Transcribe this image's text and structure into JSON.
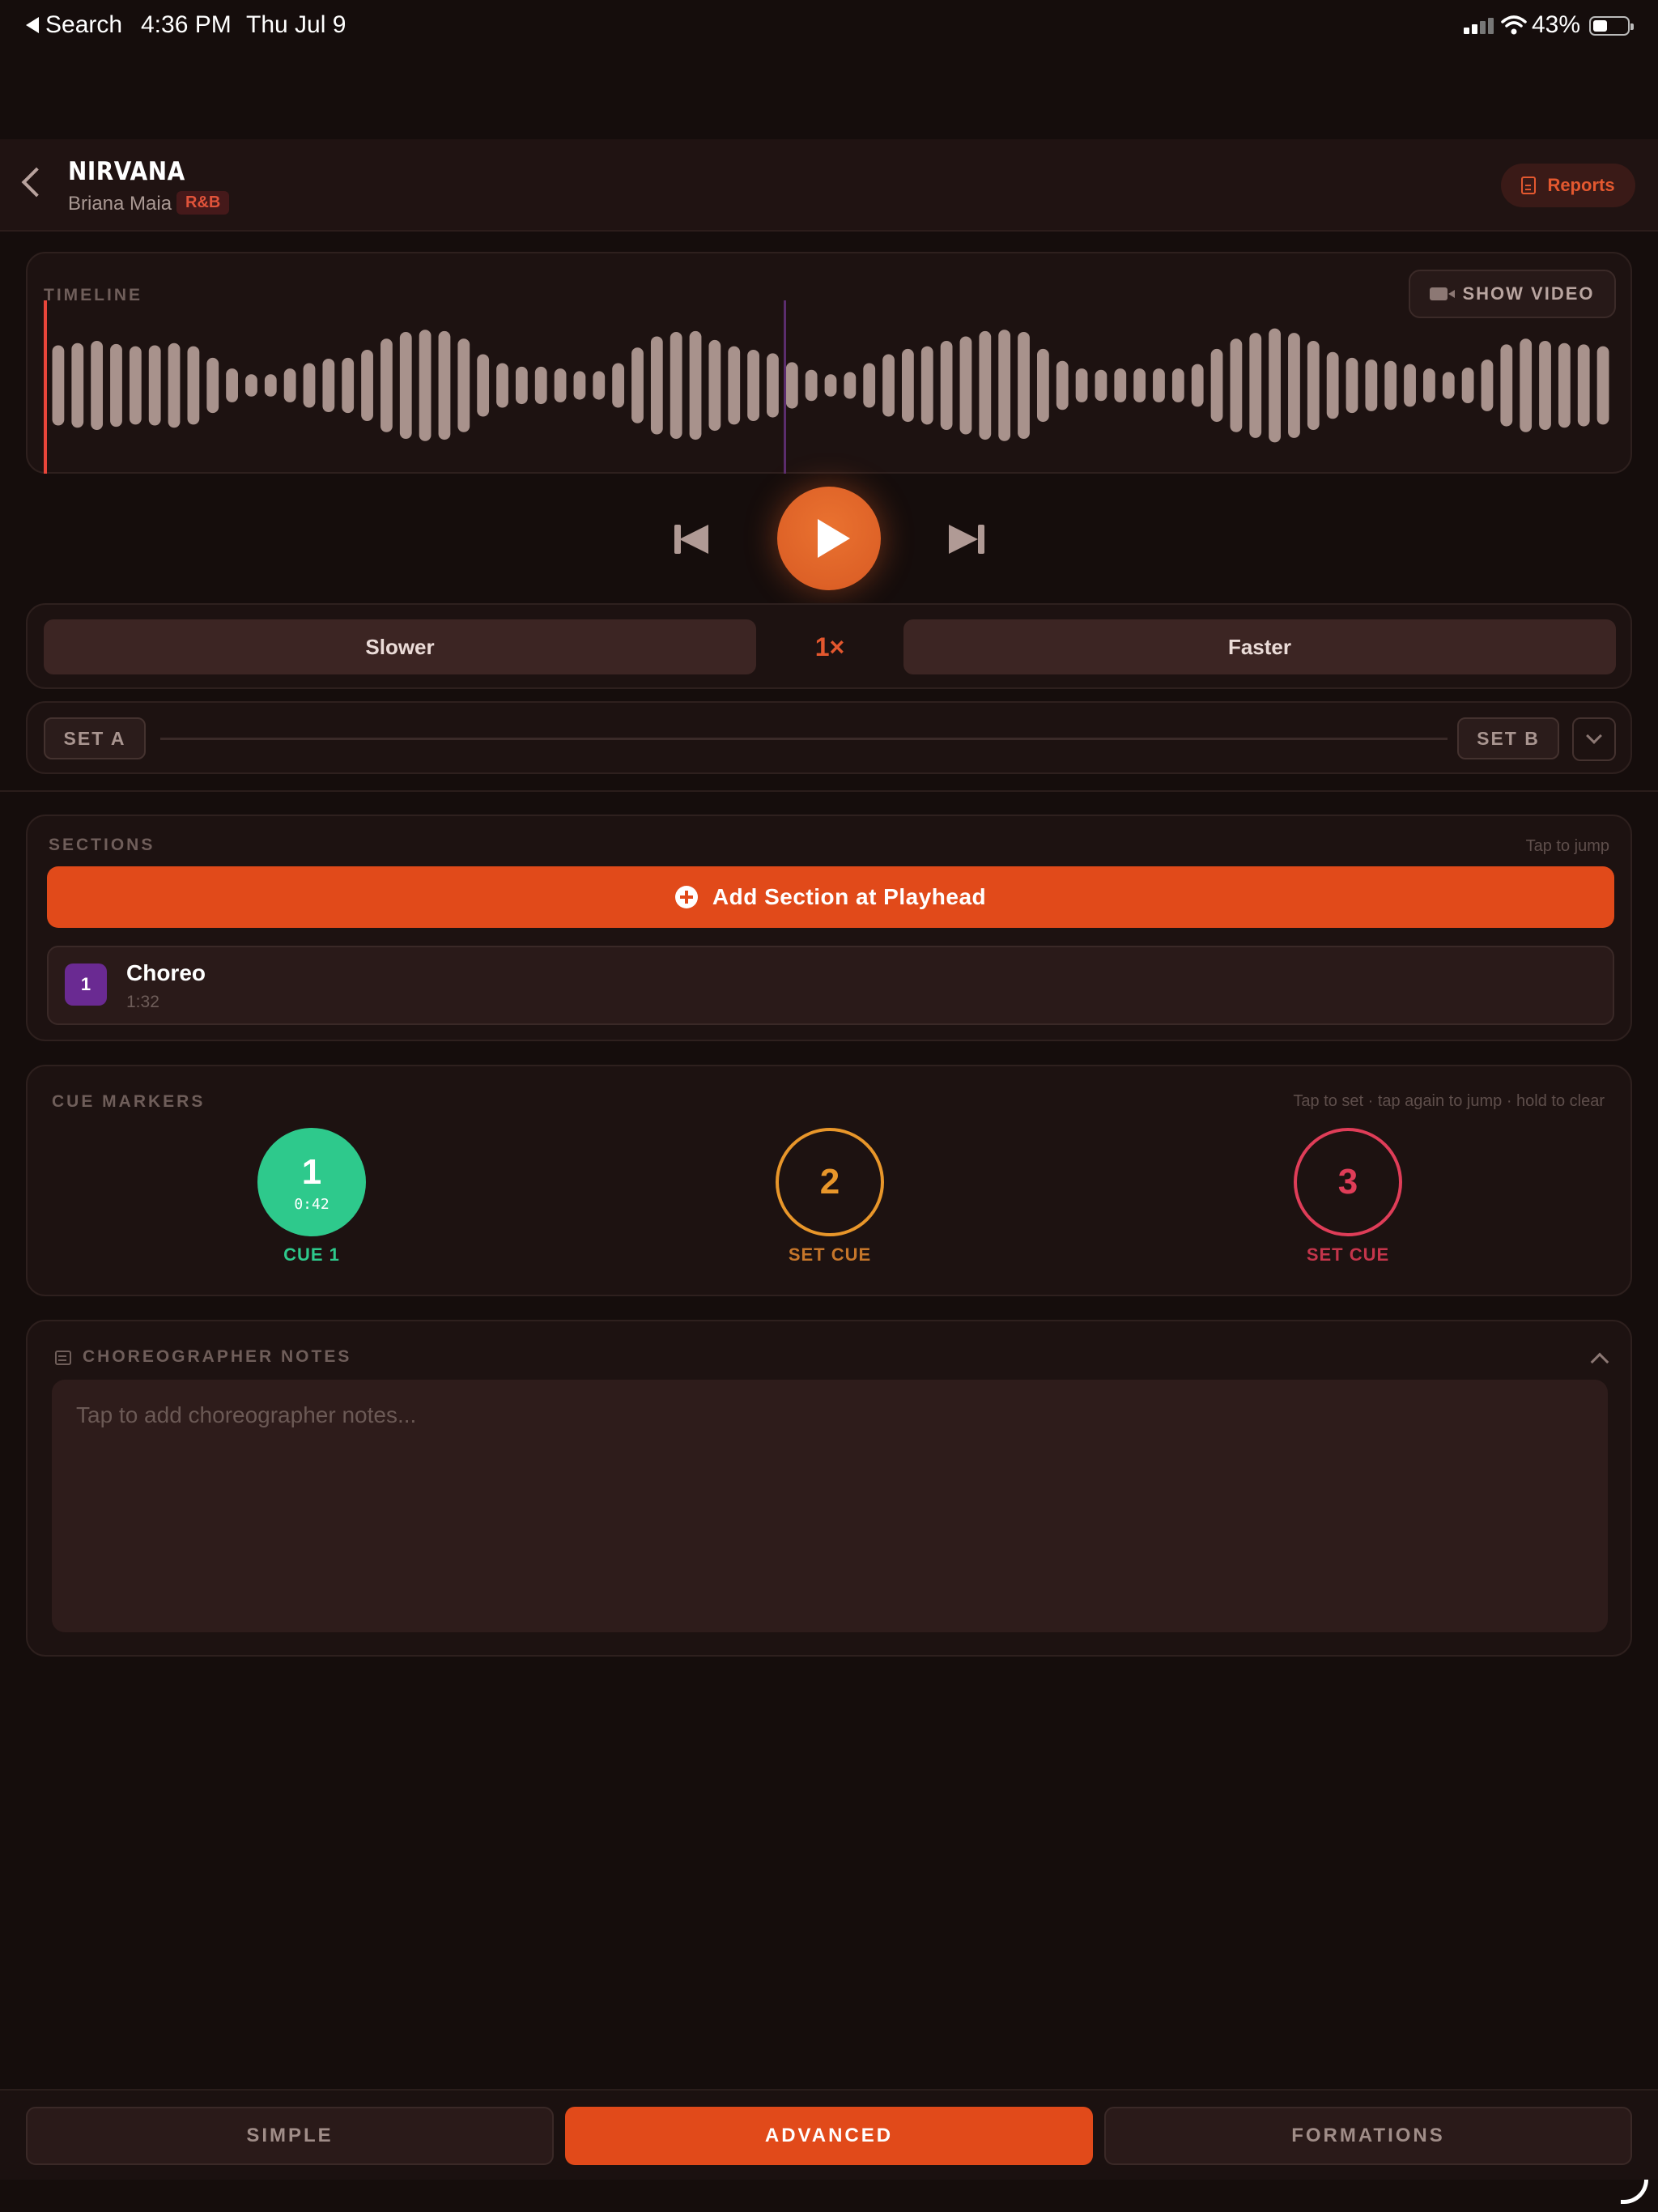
{
  "status_bar": {
    "back_app": "Search",
    "time": "4:36 PM",
    "date": "Thu Jul 9",
    "battery_percent": "43%",
    "battery_level": 0.43
  },
  "header": {
    "title": "NIRVANA",
    "artist": "Briana Maia",
    "genre": "R&B",
    "reports_label": "Reports"
  },
  "timeline": {
    "label": "TIMELINE",
    "show_video_label": "SHOW VIDEO",
    "playhead_fraction": 0.0,
    "marker_fraction": 0.47,
    "waveform": [
      0.9,
      0.95,
      1.0,
      0.93,
      0.88,
      0.9,
      0.95,
      0.88,
      0.62,
      0.38,
      0.25,
      0.25,
      0.38,
      0.5,
      0.6,
      0.62,
      0.8,
      1.05,
      1.2,
      1.25,
      1.22,
      1.05,
      0.7,
      0.5,
      0.42,
      0.42,
      0.38,
      0.32,
      0.32,
      0.5,
      0.85,
      1.1,
      1.2,
      1.22,
      1.02,
      0.88,
      0.8,
      0.72,
      0.52,
      0.35,
      0.25,
      0.3,
      0.5,
      0.7,
      0.82,
      0.88,
      1.0,
      1.1,
      1.22,
      1.25,
      1.2,
      0.82,
      0.55,
      0.38,
      0.35,
      0.38,
      0.38,
      0.38,
      0.38,
      0.48,
      0.82,
      1.05,
      1.18,
      1.28,
      1.18,
      1.0,
      0.75,
      0.62,
      0.58,
      0.55,
      0.48,
      0.38,
      0.3,
      0.4,
      0.58,
      0.92,
      1.05,
      1.0,
      0.95,
      0.92,
      0.88
    ]
  },
  "transport": {
    "speed_slower": "Slower",
    "speed_faster": "Faster",
    "speed_value": "1×"
  },
  "ab_loop": {
    "set_a": "SET A",
    "set_b": "SET B"
  },
  "sections": {
    "label": "SECTIONS",
    "hint": "Tap to jump",
    "add_label": "Add Section at Playhead",
    "items": [
      {
        "number": "1",
        "name": "Choreo",
        "time": "1:32"
      }
    ]
  },
  "cues": {
    "label": "CUE MARKERS",
    "hint": "Tap to set · tap again to jump · hold to clear",
    "items": [
      {
        "number": "1",
        "time": "0:42",
        "label": "CUE 1",
        "color": "#2ec98c"
      },
      {
        "number": "2",
        "label": "SET CUE",
        "color": "#e8962a"
      },
      {
        "number": "3",
        "label": "SET CUE",
        "color": "#df3d58"
      }
    ]
  },
  "notes": {
    "label": "CHOREOGRAPHER NOTES",
    "placeholder": "Tap to add choreographer notes..."
  },
  "tabs": {
    "simple": "SIMPLE",
    "advanced": "ADVANCED",
    "formations": "FORMATIONS",
    "active": "advanced"
  },
  "colors": {
    "accent": "#e14a1a",
    "background": "#150d0c",
    "waveform": "#a8928c",
    "playhead": "#e8453a",
    "marker": "#5b2d6e"
  }
}
